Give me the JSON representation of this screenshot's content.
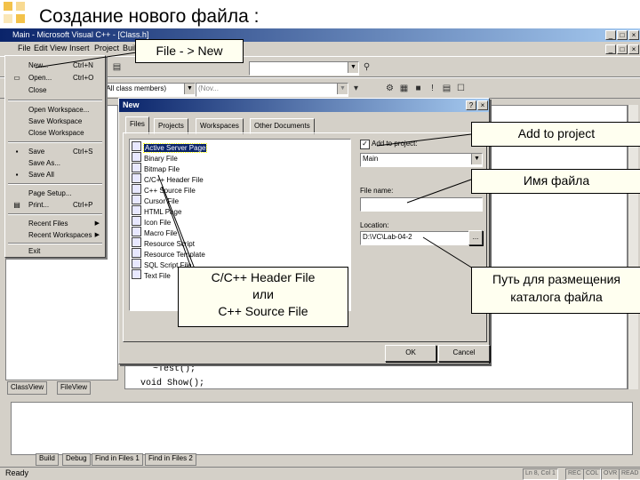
{
  "slide": {
    "title": "Создание нового файла :"
  },
  "window": {
    "title": "Main - Microsoft Visual C++ - [Class.h]",
    "controls": [
      "_",
      "□",
      "×"
    ],
    "inner_controls": [
      "_",
      "□",
      "×"
    ]
  },
  "menubar": {
    "items": [
      "File",
      "Edit",
      "View",
      "Insert",
      "Project",
      "Build"
    ]
  },
  "toolbar": {
    "class_combo": "ll (All class members)",
    "member_combo": "(Nov..."
  },
  "file_menu": {
    "items": [
      {
        "label": "New...",
        "shortcut": "Ctrl+N",
        "icon": ""
      },
      {
        "label": "Open...",
        "shortcut": "Ctrl+O",
        "icon": "open-folder-icon"
      },
      {
        "label": "Close",
        "shortcut": "",
        "icon": ""
      },
      {
        "label": "Open Workspace...",
        "shortcut": "",
        "icon": ""
      },
      {
        "label": "Save Workspace",
        "shortcut": "",
        "icon": ""
      },
      {
        "label": "Close Workspace",
        "shortcut": "",
        "icon": ""
      },
      {
        "label": "Save",
        "shortcut": "Ctrl+S",
        "icon": "save-icon"
      },
      {
        "label": "Save As...",
        "shortcut": "",
        "icon": ""
      },
      {
        "label": "Save All",
        "shortcut": "",
        "icon": "save-all-icon"
      },
      {
        "label": "Page Setup...",
        "shortcut": "",
        "icon": ""
      },
      {
        "label": "Print...",
        "shortcut": "Ctrl+P",
        "icon": "print-icon"
      },
      {
        "label": "Recent Files",
        "shortcut": "",
        "icon": "",
        "submenu": true
      },
      {
        "label": "Recent Workspaces",
        "shortcut": "",
        "icon": "",
        "submenu": true
      },
      {
        "label": "Exit",
        "shortcut": "",
        "icon": ""
      }
    ]
  },
  "new_dialog": {
    "title": "New",
    "tabs": [
      "Files",
      "Projects",
      "Workspaces",
      "Other Documents"
    ],
    "active_tab": "Files",
    "file_types": [
      "Active Server Page",
      "Binary File",
      "Bitmap File",
      "C/C++ Header File",
      "C++ Source File",
      "Cursor File",
      "HTML Page",
      "Icon File",
      "Macro File",
      "Resource Script",
      "Resource Template",
      "SQL Script File",
      "Text File"
    ],
    "selected_file_type": "Active Server Page",
    "add_to_project_label": "Add to project:",
    "add_to_project_checked": true,
    "project_value": "Main",
    "file_name_label": "File name:",
    "file_name_value": "",
    "location_label": "Location:",
    "location_value": "D:\\VC\\Lab-04-2",
    "browse_label": "...",
    "ok_label": "OK",
    "cancel_label": "Cancel"
  },
  "editor": {
    "lines": [
      "~Test();",
      "void Show();"
    ]
  },
  "workspace_tabs": [
    "ClassView",
    "FileView"
  ],
  "output_tabs": [
    "Build",
    "Debug",
    "Find in Files 1",
    "Find in Files 2"
  ],
  "status": {
    "text": "Ready",
    "cells": [
      "Ln 8, Col 1",
      "REC",
      "COL",
      "OVR",
      "READ"
    ]
  },
  "callouts": {
    "file_new": "File - > New",
    "add_to_project": "Add to project",
    "file_name": "Имя файла",
    "path_line1": "Путь для размещения",
    "path_line2": "каталога файла",
    "header_line1": "С/С++ Header File",
    "header_line2": "или",
    "header_line3": "C++ Source File"
  },
  "colors": {
    "title_bar": "#0a246a",
    "title_bar_end": "#a6caf0",
    "chrome": "#d4d0c8",
    "callout_bg": "#fffff0",
    "deco": "#f3c24a"
  }
}
